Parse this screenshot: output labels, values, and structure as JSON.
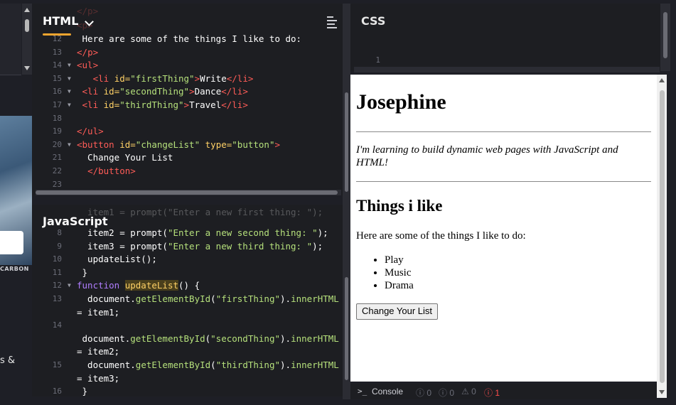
{
  "left_strip": {
    "carbon_label": "CARBON",
    "cut_text": "s &"
  },
  "html_pane": {
    "title": "HTML",
    "lines": [
      {
        "n": "12",
        "parts": [
          {
            "c": "txt",
            "t": " Here are some of the things I like to do:"
          }
        ]
      },
      {
        "n": "13",
        "parts": [
          {
            "c": "tag",
            "t": "</"
          },
          {
            "c": "tag",
            "t": "p"
          },
          {
            "c": "tag",
            "t": ">"
          }
        ]
      },
      {
        "n": "14",
        "fold": true,
        "parts": [
          {
            "c": "tag",
            "t": "<ul>"
          }
        ]
      },
      {
        "n": "15",
        "fold": true,
        "parts": [
          {
            "c": "txt",
            "t": "   "
          },
          {
            "c": "tag",
            "t": "<li "
          },
          {
            "c": "attr",
            "t": "id="
          },
          {
            "c": "str",
            "t": "\"firstThing\""
          },
          {
            "c": "tag",
            "t": ">"
          },
          {
            "c": "txt",
            "t": "Write"
          },
          {
            "c": "tag",
            "t": "</li>"
          }
        ]
      },
      {
        "n": "16",
        "fold": true,
        "parts": [
          {
            "c": "txt",
            "t": " "
          },
          {
            "c": "tag",
            "t": "<li "
          },
          {
            "c": "attr",
            "t": "id="
          },
          {
            "c": "str",
            "t": "\"secondThing\""
          },
          {
            "c": "tag",
            "t": ">"
          },
          {
            "c": "txt",
            "t": "Dance"
          },
          {
            "c": "tag",
            "t": "</li>"
          }
        ]
      },
      {
        "n": "17",
        "fold": true,
        "parts": [
          {
            "c": "txt",
            "t": " "
          },
          {
            "c": "tag",
            "t": "<li "
          },
          {
            "c": "attr",
            "t": "id="
          },
          {
            "c": "str",
            "t": "\"thirdThing\""
          },
          {
            "c": "tag",
            "t": ">"
          },
          {
            "c": "txt",
            "t": "Travel"
          },
          {
            "c": "tag",
            "t": "</li>"
          }
        ]
      },
      {
        "n": "18",
        "parts": []
      },
      {
        "n": "19",
        "parts": [
          {
            "c": "tag",
            "t": "</ul>"
          }
        ]
      },
      {
        "n": "20",
        "fold": true,
        "parts": [
          {
            "c": "tag",
            "t": "<button "
          },
          {
            "c": "attr",
            "t": "id="
          },
          {
            "c": "str",
            "t": "\"changeList\""
          },
          {
            "c": "txt",
            "t": " "
          },
          {
            "c": "attr",
            "t": "type="
          },
          {
            "c": "str",
            "t": "\"button\""
          },
          {
            "c": "tag",
            "t": ">"
          }
        ]
      },
      {
        "n": "21",
        "parts": [
          {
            "c": "txt",
            "t": "  Change Your List"
          }
        ]
      },
      {
        "n": "22",
        "parts": [
          {
            "c": "txt",
            "t": "  "
          },
          {
            "c": "tag",
            "t": "</button>"
          }
        ]
      },
      {
        "n": "23",
        "parts": []
      }
    ]
  },
  "js_pane": {
    "title": "JavaScript",
    "lines": [
      {
        "n": "8",
        "parts": [
          {
            "c": "txt",
            "t": "  item2 = prompt("
          },
          {
            "c": "str",
            "t": "\"Enter a new second thing: \""
          },
          {
            "c": "txt",
            "t": ");"
          }
        ]
      },
      {
        "n": "9",
        "parts": [
          {
            "c": "txt",
            "t": "  item3 = prompt("
          },
          {
            "c": "str",
            "t": "\"Enter a new third thing: \""
          },
          {
            "c": "txt",
            "t": ");"
          }
        ]
      },
      {
        "n": "10",
        "parts": [
          {
            "c": "txt",
            "t": "  updateList();"
          }
        ]
      },
      {
        "n": "11",
        "parts": [
          {
            "c": "txt",
            "t": " }"
          }
        ]
      },
      {
        "n": "12",
        "fold": true,
        "parts": [
          {
            "c": "kw",
            "t": "function "
          },
          {
            "c": "fnhl",
            "t": "updateList"
          },
          {
            "c": "txt",
            "t": "() {"
          }
        ]
      },
      {
        "n": "13",
        "parts": [
          {
            "c": "txt",
            "t": "  document."
          },
          {
            "c": "fn",
            "t": "getElementById"
          },
          {
            "c": "txt",
            "t": "("
          },
          {
            "c": "str",
            "t": "\"firstThing\""
          },
          {
            "c": "txt",
            "t": ")."
          },
          {
            "c": "fn",
            "t": "innerHTML"
          }
        ]
      },
      {
        "n": "",
        "parts": [
          {
            "c": "txt",
            "t": "= item1;"
          }
        ]
      },
      {
        "n": "14",
        "parts": []
      },
      {
        "n": "",
        "parts": [
          {
            "c": "txt",
            "t": " document."
          },
          {
            "c": "fn",
            "t": "getElementById"
          },
          {
            "c": "txt",
            "t": "("
          },
          {
            "c": "str",
            "t": "\"secondThing\""
          },
          {
            "c": "txt",
            "t": ")."
          },
          {
            "c": "fn",
            "t": "innerHTML"
          }
        ]
      },
      {
        "n": "",
        "parts": [
          {
            "c": "txt",
            "t": "= item2;"
          }
        ]
      },
      {
        "n": "15",
        "parts": [
          {
            "c": "txt",
            "t": "  document."
          },
          {
            "c": "fn",
            "t": "getElementById"
          },
          {
            "c": "txt",
            "t": "("
          },
          {
            "c": "str",
            "t": "\"thirdThing\""
          },
          {
            "c": "txt",
            "t": ")."
          },
          {
            "c": "fn",
            "t": "innerHTML"
          }
        ]
      },
      {
        "n": "",
        "parts": [
          {
            "c": "txt",
            "t": "= item3;"
          }
        ]
      },
      {
        "n": "16",
        "parts": [
          {
            "c": "txt",
            "t": " }"
          }
        ]
      }
    ]
  },
  "css_pane": {
    "title": "CSS",
    "line_number": "1"
  },
  "preview": {
    "heading": "Josephine",
    "intro": "I'm learning to build dynamic web pages with JavaScript and HTML!",
    "subheading": "Things i like",
    "paragraph": "Here are some of the things I like to do:",
    "list": [
      "Play",
      "Music",
      "Drama"
    ],
    "button_label": "Change Your List"
  },
  "console": {
    "label": "Console",
    "counts": [
      "0",
      "0",
      "0",
      "1"
    ]
  },
  "colors": {
    "accent": "#f0a52f",
    "tag": "#ff5c57",
    "attr": "#ffd166",
    "string": "#b5e07b",
    "keyword": "#b07dff",
    "error": "#ff4d4d"
  }
}
